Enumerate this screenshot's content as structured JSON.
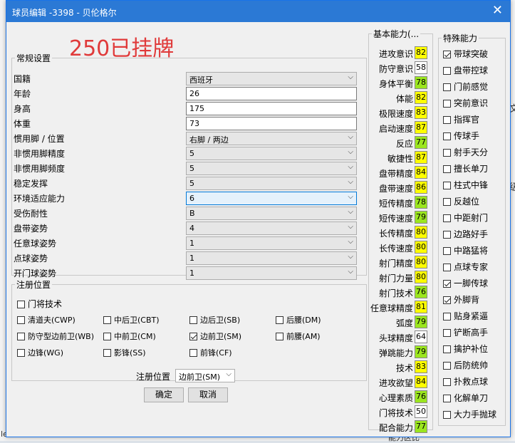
{
  "window": {
    "title": "球员编辑 -3398 - 贝伦格尔"
  },
  "banner": "250已挂牌",
  "general": {
    "legend": "常规设置",
    "fields": [
      {
        "label": "国籍",
        "value": "西班牙",
        "type": "select"
      },
      {
        "label": "年龄",
        "value": "26",
        "type": "input"
      },
      {
        "label": "身高",
        "value": "175",
        "type": "input"
      },
      {
        "label": "体重",
        "value": "73",
        "type": "input"
      },
      {
        "label": "惯用脚 / 位置",
        "value": "右脚 / 两边",
        "type": "select"
      },
      {
        "label": "非惯用脚精度",
        "value": "5",
        "type": "select"
      },
      {
        "label": "非惯用脚频度",
        "value": "5",
        "type": "select"
      },
      {
        "label": "稳定发挥",
        "value": "5",
        "type": "select"
      },
      {
        "label": "环境适应能力",
        "value": "6",
        "type": "select-hi"
      },
      {
        "label": "受伤耐性",
        "value": "B",
        "type": "select"
      },
      {
        "label": "盘带姿势",
        "value": "4",
        "type": "select"
      },
      {
        "label": "任意球姿势",
        "value": "1",
        "type": "select"
      },
      {
        "label": "点球姿势",
        "value": "1",
        "type": "select"
      },
      {
        "label": "开门球姿势",
        "value": "1",
        "type": "select"
      }
    ]
  },
  "positions": {
    "legend": "注册位置",
    "items": [
      {
        "label": "门将技术",
        "checked": false
      },
      {
        "label": "清道夫(CWP)",
        "checked": false
      },
      {
        "label": "中后卫(CBT)",
        "checked": false
      },
      {
        "label": "边后卫(SB)",
        "checked": false
      },
      {
        "label": "后腰(DM)",
        "checked": false
      },
      {
        "label": "防守型边前卫(WB)",
        "checked": false
      },
      {
        "label": "中前卫(CM)",
        "checked": false
      },
      {
        "label": "边前卫(SM)",
        "checked": true
      },
      {
        "label": "前腰(AM)",
        "checked": false
      },
      {
        "label": "边锋(WG)",
        "checked": false
      },
      {
        "label": "影锋(SS)",
        "checked": false
      },
      {
        "label": "前锋(CF)",
        "checked": false
      }
    ],
    "reg_label": "注册位置",
    "reg_value": "边前卫(SM)"
  },
  "buttons": {
    "ok": "确定",
    "cancel": "取消"
  },
  "abilities": {
    "legend": "基本能力(...",
    "items": [
      {
        "name": "进攻意识",
        "value": "82",
        "color": "#ffff00"
      },
      {
        "name": "防守意识",
        "value": "58",
        "color": "#ffffff"
      },
      {
        "name": "身体平衡",
        "value": "78",
        "color": "#9be61e"
      },
      {
        "name": "体能",
        "value": "82",
        "color": "#ffff00"
      },
      {
        "name": "极限速度",
        "value": "83",
        "color": "#ffff00"
      },
      {
        "name": "启动速度",
        "value": "87",
        "color": "#ffff00"
      },
      {
        "name": "反应",
        "value": "77",
        "color": "#9be61e"
      },
      {
        "name": "敏捷性",
        "value": "87",
        "color": "#ffff00"
      },
      {
        "name": "盘带精度",
        "value": "84",
        "color": "#ffff00"
      },
      {
        "name": "盘带速度",
        "value": "86",
        "color": "#ffff00"
      },
      {
        "name": "短传精度",
        "value": "78",
        "color": "#9be61e"
      },
      {
        "name": "短传速度",
        "value": "79",
        "color": "#9be61e"
      },
      {
        "name": "长传精度",
        "value": "80",
        "color": "#ffff00"
      },
      {
        "name": "长传速度",
        "value": "80",
        "color": "#ffff00"
      },
      {
        "name": "射门精度",
        "value": "80",
        "color": "#ffff00"
      },
      {
        "name": "射门力量",
        "value": "80",
        "color": "#ffff00"
      },
      {
        "name": "射门技术",
        "value": "76",
        "color": "#9be61e"
      },
      {
        "name": "任意球精度",
        "value": "81",
        "color": "#ffff00"
      },
      {
        "name": "弧度",
        "value": "79",
        "color": "#9be61e"
      },
      {
        "name": "头球精度",
        "value": "64",
        "color": "#ffffff"
      },
      {
        "name": "弹跳能力",
        "value": "79",
        "color": "#9be61e"
      },
      {
        "name": "技术",
        "value": "83",
        "color": "#ffff00"
      },
      {
        "name": "进攻欲望",
        "value": "84",
        "color": "#ffff00"
      },
      {
        "name": "心理素质",
        "value": "76",
        "color": "#9be61e"
      },
      {
        "name": "门将技术",
        "value": "50",
        "color": "#ffffff"
      },
      {
        "name": "配合能力",
        "value": "77",
        "color": "#9be61e"
      }
    ]
  },
  "special": {
    "legend": "特殊能力",
    "items": [
      {
        "label": "带球突破",
        "checked": true
      },
      {
        "label": "盘带控球",
        "checked": false
      },
      {
        "label": "门前感觉",
        "checked": false
      },
      {
        "label": "突前意识",
        "checked": false
      },
      {
        "label": "指挥官",
        "checked": false
      },
      {
        "label": "传球手",
        "checked": false
      },
      {
        "label": "射手天分",
        "checked": false
      },
      {
        "label": "擅长单刀",
        "checked": false
      },
      {
        "label": "柱式中锋",
        "checked": false
      },
      {
        "label": "反越位",
        "checked": false
      },
      {
        "label": "中距射门",
        "checked": false
      },
      {
        "label": "边路好手",
        "checked": false
      },
      {
        "label": "中路猛将",
        "checked": false
      },
      {
        "label": "点球专家",
        "checked": false
      },
      {
        "label": "一脚传球",
        "checked": true
      },
      {
        "label": "外脚背",
        "checked": true
      },
      {
        "label": "贴身紧逼",
        "checked": false
      },
      {
        "label": "铲断高手",
        "checked": false
      },
      {
        "label": "擒护补位",
        "checked": false
      },
      {
        "label": "后防统帅",
        "checked": false
      },
      {
        "label": "扑救点球",
        "checked": false
      },
      {
        "label": "化解单刀",
        "checked": false
      },
      {
        "label": "大力手抛球",
        "checked": false
      }
    ]
  },
  "background": {
    "bottom_text": "能力区比",
    "left_text": "le",
    "right_a": "文",
    "right_b": "级"
  }
}
